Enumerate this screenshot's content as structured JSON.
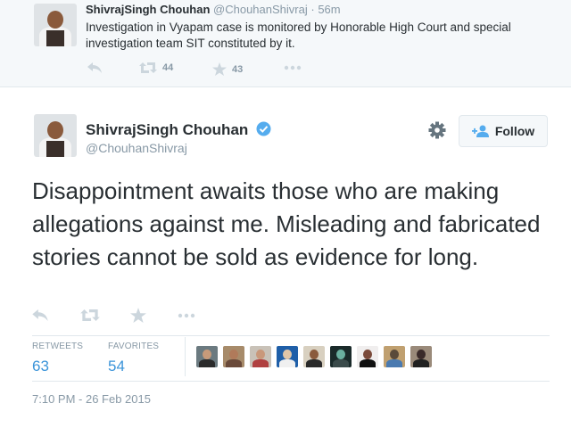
{
  "top_tweet": {
    "name": "ShivrajSingh Chouhan",
    "handle": "@ChouhanShivraj",
    "separator": "·",
    "time": "56m",
    "text": "Investigation in Vyapam case is monitored by Honorable High Court and special investigation team SIT constituted by it.",
    "retweet_count": "44",
    "favorite_count": "43"
  },
  "main_tweet": {
    "name": "ShivrajSingh Chouhan",
    "handle": "@ChouhanShivraj",
    "follow_label": "Follow",
    "text": "Disappointment awaits those who are making allegations against me. Misleading and fabricated stories cannot be sold as evidence for long.",
    "stats": {
      "retweets_label": "RETWEETS",
      "retweets_value": "63",
      "favorites_label": "FAVORITES",
      "favorites_value": "54"
    },
    "timestamp": "7:10 PM - 26 Feb 2015"
  },
  "icons": [
    "reply-icon",
    "retweet-icon",
    "favorite-icon",
    "more-icon",
    "gear-icon",
    "follow-person-icon",
    "verified-icon"
  ],
  "colors": {
    "accent": "#3b94d9",
    "verified": "#55acee",
    "muted": "#8899a6",
    "text": "#292f33",
    "icon_gray": "#ccd6dd"
  },
  "favoriter_avatars": [
    {
      "bg": "#6b7a80",
      "head": "#c79a7a",
      "body": "#2b2b2b"
    },
    {
      "bg": "#a78b6a",
      "head": "#b07a5a",
      "body": "#6a4a3a"
    },
    {
      "bg": "#c9c2b8",
      "head": "#c9987a",
      "body": "#b04040"
    },
    {
      "bg": "#1f5fa8",
      "head": "#e0c6a8",
      "body": "#f0f0f0"
    },
    {
      "bg": "#d8d0c0",
      "head": "#8a5a3c",
      "body": "#2a2a2a"
    },
    {
      "bg": "#1a2a2a",
      "head": "#6ab0a0",
      "body": "#3a4a4a"
    },
    {
      "bg": "#f0eeee",
      "head": "#7a4a3a",
      "body": "#101010"
    },
    {
      "bg": "#c0a070",
      "head": "#5a4a3a",
      "body": "#4a7ab0"
    },
    {
      "bg": "#9a8a7a",
      "head": "#3a2a2a",
      "body": "#202020"
    }
  ]
}
